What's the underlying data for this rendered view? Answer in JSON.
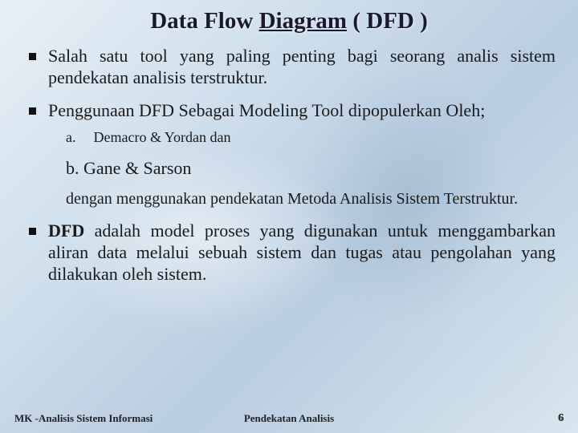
{
  "title_prefix": "Data Flow ",
  "title_underline": "Diagram",
  "title_suffix": " ( DFD )",
  "bullets": [
    "Salah satu tool yang paling penting bagi seorang analis sistem pendekatan analisis terstruktur.",
    "Penggunaan DFD Sebagai Modeling Tool dipopulerkan Oleh;"
  ],
  "sub_a_label": "a.",
  "sub_a_text": "Demacro & Yordan dan",
  "sub_b_label": "b.",
  "sub_b_text": "Gane & Sarson",
  "paragraph": "dengan menggunakan pendekatan Metoda Analisis Sistem Terstruktur.",
  "bullet3_bold": "DFD",
  "bullet3_rest": " adalah model proses yang digunakan untuk menggambarkan aliran data melalui sebuah sistem dan tugas atau pengolahan yang dilakukan oleh sistem.",
  "footer_left": "MK -Analisis Sistem Informasi",
  "footer_center": "Pendekatan Analisis",
  "page_number": "6"
}
